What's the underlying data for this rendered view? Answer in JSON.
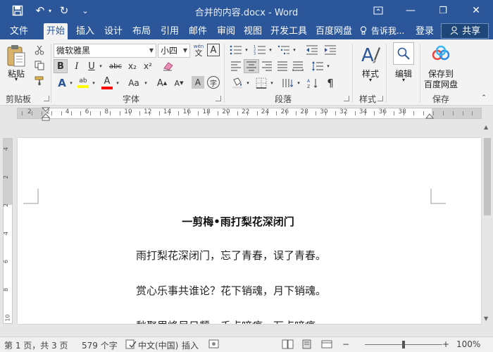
{
  "window": {
    "title": "合并的内容.docx - Word",
    "minimize_glyph": "—",
    "restore_glyph": "❐",
    "close_glyph": "✕"
  },
  "quick_access": {
    "save_glyph": "💾",
    "undo_glyph": "↶",
    "redo_glyph": "↻",
    "customize_glyph": "⌄"
  },
  "tabs": [
    {
      "label": "文件"
    },
    {
      "label": "开始"
    },
    {
      "label": "插入"
    },
    {
      "label": "设计"
    },
    {
      "label": "布局"
    },
    {
      "label": "引用"
    },
    {
      "label": "邮件"
    },
    {
      "label": "审阅"
    },
    {
      "label": "视图"
    },
    {
      "label": "开发工具"
    },
    {
      "label": "百度网盘"
    }
  ],
  "active_tab": "开始",
  "tell_me": "告诉我...",
  "login": "登录",
  "share": "共享",
  "ribbon": {
    "clipboard": {
      "paste_label": "粘贴",
      "group_label": "剪贴板"
    },
    "font": {
      "font_name": "微软雅黑",
      "font_size": "小四",
      "wen_glyph": "wén",
      "a_border_glyph": "A",
      "bold": "B",
      "italic": "I",
      "underline": "U",
      "strikethrough": "abc",
      "subscript": "x₂",
      "superscript": "x²",
      "text_effects": "A",
      "highlight": "ab",
      "font_color": "A",
      "change_case": "Aa",
      "grow": "A",
      "shrink": "A",
      "char_shading": "A",
      "enclose": "字",
      "group_label": "字体"
    },
    "paragraph": {
      "group_label": "段落"
    },
    "styles": {
      "label": "样式",
      "group_label": "样式"
    },
    "editing": {
      "label": "编辑"
    },
    "save": {
      "label_line1": "保存到",
      "label_line2": "百度网盘",
      "group_label": "保存"
    }
  },
  "ruler": {
    "numbers": [
      "2",
      "2",
      "4",
      "6",
      "8",
      "10",
      "12",
      "14",
      "16",
      "18",
      "20",
      "22",
      "24",
      "26",
      "28",
      "30",
      "32",
      "34",
      "36",
      "38"
    ],
    "tab_selector": "L",
    "vertical_numbers": [
      "4",
      "2",
      "2",
      "4",
      "6",
      "8",
      "10"
    ]
  },
  "document": {
    "heading": "一剪梅•雨打梨花深闭门",
    "paragraphs": [
      "雨打梨花深闭门，忘了青春，误了青春。",
      "赏心乐事共谁论？花下销魂，月下销魂。",
      "愁聚眉峰尽日颦，千点啼痕，万点啼痕。"
    ]
  },
  "status": {
    "page": "第 1 页，共 3 页",
    "words": "579 个字",
    "language": "中文(中国)",
    "mode": "插入",
    "zoom_minus": "−",
    "zoom_plus": "+",
    "zoom_level": "100%",
    "zoom_fraction": 0.5
  },
  "colors": {
    "title_bar": "#2b579a",
    "ribbon": "#f3f3f3",
    "highlight": "#ffff00",
    "font_color": "#ff0000"
  }
}
